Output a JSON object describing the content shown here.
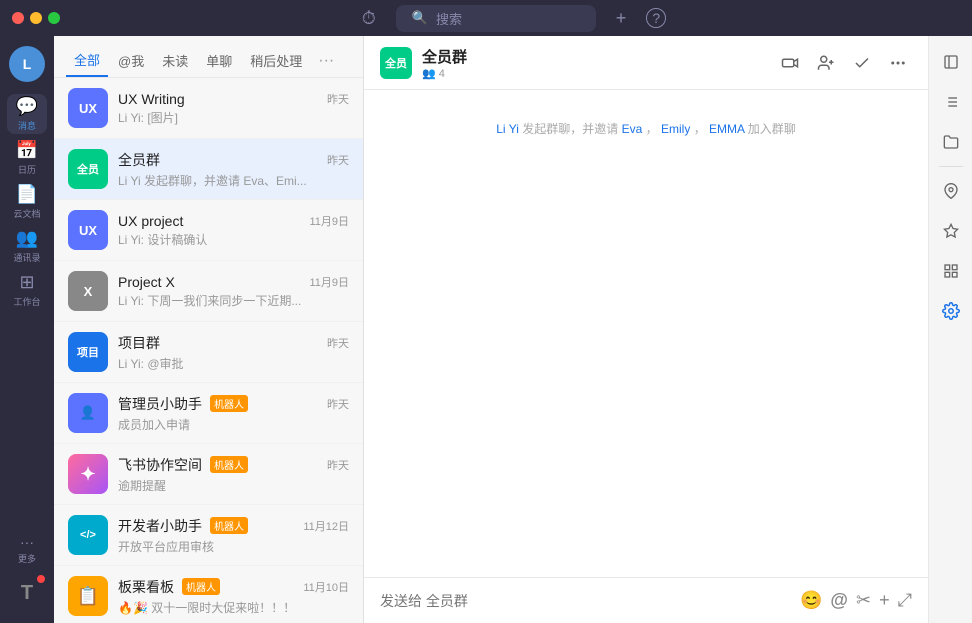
{
  "titleBar": {
    "searchPlaceholder": "搜索",
    "historyIcon": "⏱",
    "addIcon": "+",
    "helpIcon": "?"
  },
  "iconSidebar": {
    "userLabel": "Li Yi",
    "userInitial": "L",
    "items": [
      {
        "id": "message",
        "icon": "💬",
        "label": "消息",
        "active": true,
        "badge": false
      },
      {
        "id": "calendar",
        "icon": "📅",
        "label": "日历",
        "active": false,
        "badge": false
      },
      {
        "id": "docs",
        "icon": "📄",
        "label": "云文档",
        "active": false,
        "badge": false
      },
      {
        "id": "contacts",
        "icon": "👥",
        "label": "通讯录",
        "active": false,
        "badge": false
      },
      {
        "id": "workspace",
        "icon": "⊞",
        "label": "工作台",
        "active": false,
        "badge": false
      },
      {
        "id": "more",
        "icon": "···",
        "label": "更多",
        "active": false,
        "badge": false
      }
    ],
    "bottomItem": {
      "id": "me",
      "icon": "T",
      "badge": false
    }
  },
  "chatListPanel": {
    "tabs": [
      {
        "id": "all",
        "label": "全部",
        "active": true
      },
      {
        "id": "at",
        "label": "@我",
        "active": false
      },
      {
        "id": "unread",
        "label": "未读",
        "active": false
      },
      {
        "id": "single",
        "label": "单聊",
        "active": false
      },
      {
        "id": "later",
        "label": "稍后处理",
        "active": false
      }
    ],
    "moreTabLabel": "···",
    "items": [
      {
        "id": "ux-writing",
        "name": "UX Writing",
        "preview": "Li Yi: [图片]",
        "time": "昨天",
        "avatarText": "UX",
        "avatarColor": "#5b73ff",
        "isRobot": false,
        "isActive": false
      },
      {
        "id": "all-group",
        "name": "全员群",
        "preview": "Li Yi 发起群聊，并邀请 Eva、Emi...",
        "time": "昨天",
        "avatarText": "全员",
        "avatarColor": "#00cc88",
        "isRobot": false,
        "isActive": true
      },
      {
        "id": "ux-project",
        "name": "UX project",
        "preview": "Li Yi: 设计稿确认",
        "time": "11月9日",
        "avatarText": "UX",
        "avatarColor": "#5b73ff",
        "isRobot": false,
        "isActive": false
      },
      {
        "id": "project-x",
        "name": "Project X",
        "preview": "Li Yi: 下周一我们来同步一下近期...",
        "time": "11月9日",
        "avatarText": "X",
        "avatarColor": "#888",
        "isRobot": false,
        "isActive": false
      },
      {
        "id": "project-group",
        "name": "项目群",
        "preview": "Li Yi: @审批",
        "time": "昨天",
        "avatarText": "项目",
        "avatarColor": "#1a73e8",
        "isRobot": false,
        "isActive": false
      },
      {
        "id": "admin-bot",
        "name": "管理员小助手",
        "robotLabel": "机器人",
        "preview": "成员加入申请",
        "time": "昨天",
        "avatarText": "👤",
        "avatarColor": "#5b73ff",
        "isRobot": true,
        "isActive": false
      },
      {
        "id": "feishu-space",
        "name": "飞书协作空间",
        "robotLabel": "机器人",
        "preview": "逾期提醒",
        "time": "昨天",
        "avatarText": "✦",
        "avatarColor": "#ff6b9d",
        "isRobot": true,
        "isActive": false
      },
      {
        "id": "dev-bot",
        "name": "开发者小助手",
        "robotLabel": "机器人",
        "preview": "开放平台应用审核",
        "time": "11月12日",
        "avatarText": "</>",
        "avatarColor": "#00aacc",
        "isRobot": true,
        "isActive": false
      },
      {
        "id": "kanban",
        "name": "板栗看板",
        "robotLabel": "机器人",
        "preview": "🔥🎉 双十一限时大促来啦！！！",
        "time": "11月10日",
        "avatarText": "📋",
        "avatarColor": "#ffa500",
        "isRobot": true,
        "isActive": false
      }
    ]
  },
  "chatMain": {
    "header": {
      "name": "全员群",
      "membersIcon": "👥",
      "membersCount": "4",
      "avatarText": "全员",
      "avatarColor": "#00cc88"
    },
    "headerActions": {
      "videoIcon": "📹",
      "addUserIcon": "👤+",
      "checkIcon": "✓",
      "moreIcon": "⋯"
    },
    "messages": [
      {
        "type": "system",
        "text": "Li Yi 发起群聊，并邀请 Eva，",
        "highlight1": "Li Yi",
        "highlight2": "Eva",
        "highlight3": "Emily",
        "highlight4": "EMMA",
        "fullText": "Li Yi 发起群聊，并邀请 Eva，Emily，EMMA 加入群聊"
      }
    ],
    "inputPlaceholder": "发送给 全员群",
    "inputActions": {
      "emojiIcon": "😊",
      "atIcon": "@",
      "cutIcon": "✂",
      "addIcon": "+",
      "expandIcon": "⤢"
    }
  },
  "rightSidebar": {
    "buttons": [
      {
        "id": "compose",
        "icon": "✏"
      },
      {
        "id": "list",
        "icon": "☰"
      },
      {
        "id": "folder",
        "icon": "📁"
      },
      {
        "id": "pin",
        "icon": "📌"
      },
      {
        "id": "star",
        "icon": "☆"
      },
      {
        "id": "grid",
        "icon": "⊞"
      },
      {
        "id": "settings",
        "icon": "⚙"
      }
    ]
  }
}
